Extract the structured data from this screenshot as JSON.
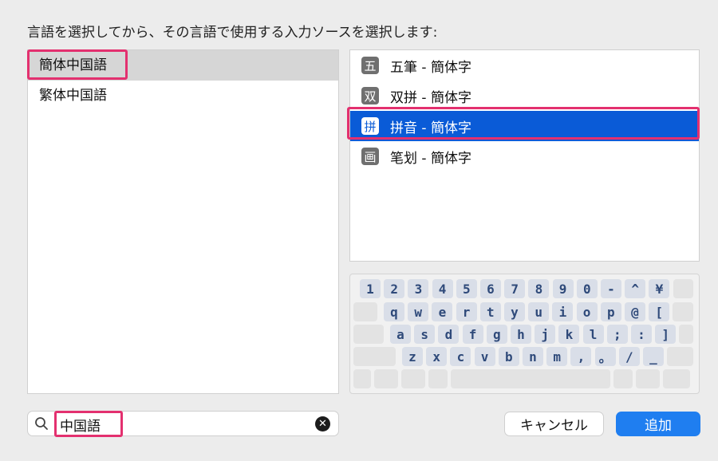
{
  "instruction": "言語を選択してから、その言語で使用する入力ソースを選択します:",
  "languages": [
    {
      "label": "簡体中国語",
      "selected": true
    },
    {
      "label": "繁体中国語",
      "selected": false
    }
  ],
  "sources": [
    {
      "icon": "五",
      "label": "五筆 - 簡体字",
      "selected": false
    },
    {
      "icon": "双",
      "label": "双拼 - 簡体字",
      "selected": false
    },
    {
      "icon": "拼",
      "label": "拼音 - 簡体字",
      "selected": true
    },
    {
      "icon": "画",
      "label": "笔划 - 簡体字",
      "selected": false
    }
  ],
  "keyboard": {
    "row1": [
      "1",
      "2",
      "3",
      "4",
      "5",
      "6",
      "7",
      "8",
      "9",
      "0",
      "-",
      "^",
      "¥"
    ],
    "row2": [
      "q",
      "w",
      "e",
      "r",
      "t",
      "y",
      "u",
      "i",
      "o",
      "p",
      "@",
      "["
    ],
    "row3": [
      "a",
      "s",
      "d",
      "f",
      "g",
      "h",
      "j",
      "k",
      "l",
      ";",
      ":",
      "]"
    ],
    "row4": [
      "z",
      "x",
      "c",
      "v",
      "b",
      "n",
      "m",
      ",",
      "。",
      "/",
      "_"
    ]
  },
  "search": {
    "value": "中国語"
  },
  "buttons": {
    "cancel": "キャンセル",
    "add": "追加"
  },
  "colors": {
    "accent": "#0a5bd7",
    "highlight": "#e3306f",
    "button_primary": "#1f7ef0"
  }
}
